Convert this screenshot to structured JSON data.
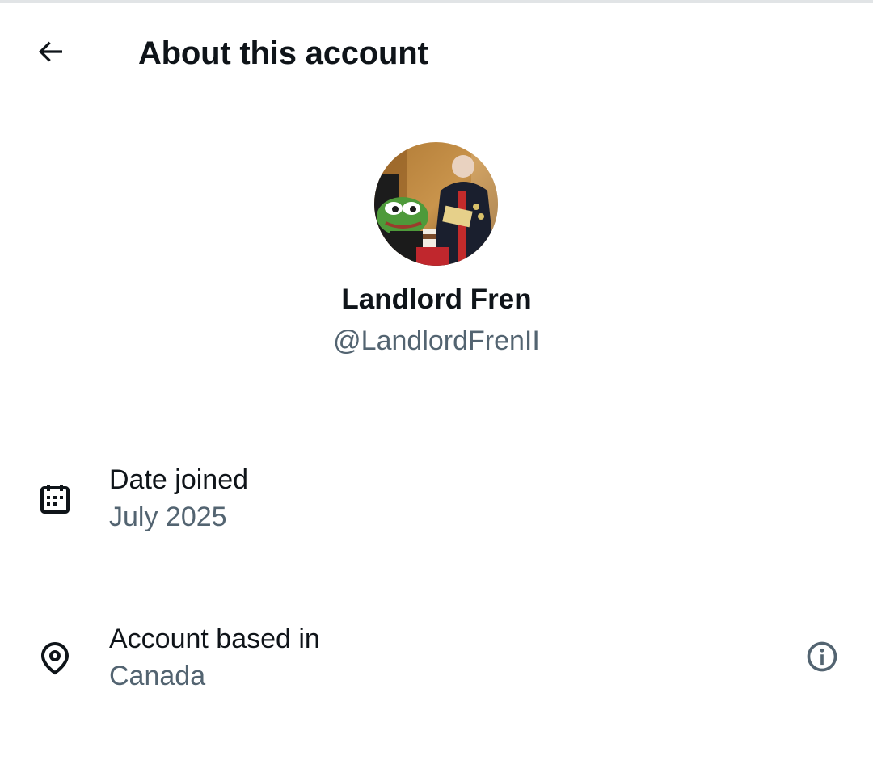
{
  "header": {
    "title": "About this account",
    "back_icon": "arrow-left-icon"
  },
  "profile": {
    "display_name": "Landlord Fren",
    "handle": "@LandlordFrenII",
    "avatar_icon": "avatar-image"
  },
  "details": {
    "date_joined": {
      "label": "Date joined",
      "value": "July 2025",
      "icon": "calendar-icon"
    },
    "account_based_in": {
      "label": "Account based in",
      "value": "Canada",
      "icon": "location-pin-icon",
      "info_icon": "info-icon"
    }
  },
  "colors": {
    "text_primary": "#0f1419",
    "text_secondary": "#536471",
    "background": "#ffffff"
  }
}
